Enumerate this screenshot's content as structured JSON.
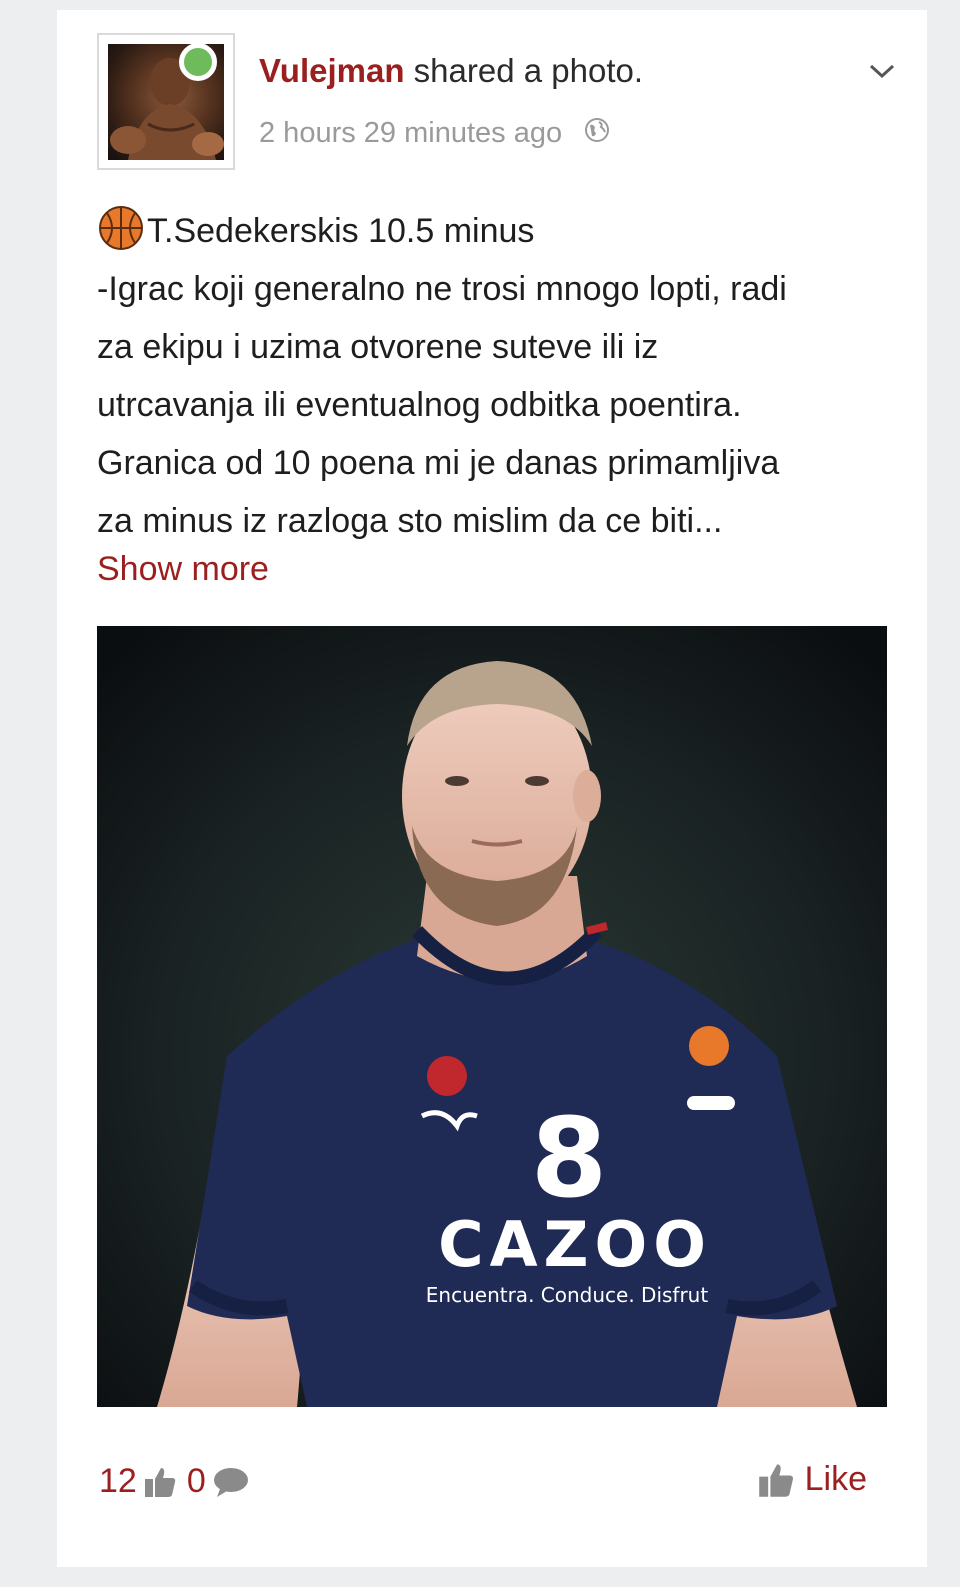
{
  "post": {
    "author": "Vulejman",
    "action": "shared a photo.",
    "timestamp": "2 hours 29 minutes ago",
    "privacy_icon": "globe-icon",
    "text_lines": [
      "T.Sedekerskis 10.5 minus",
      "-Igrac koji generalno ne trosi mnogo lopti, radi",
      "za ekipu i uzima otvorene suteve ili iz",
      "utrcavanja ili eventualnog odbitka poentira.",
      "Granica od 10 poena mi je danas primamljiva",
      "za minus iz razloga sto mislim da ce biti..."
    ],
    "show_more": "Show more",
    "photo": {
      "jersey_number": "8",
      "sponsor": "CAZOO",
      "tagline": "Encuentra. Conduce. Disfrut"
    }
  },
  "footer": {
    "like_count": "12",
    "comment_count": "0",
    "like_label": "Like"
  },
  "colors": {
    "accent": "#9b1f1f",
    "online": "#6dbb5a",
    "jersey": "#1f2a55"
  }
}
